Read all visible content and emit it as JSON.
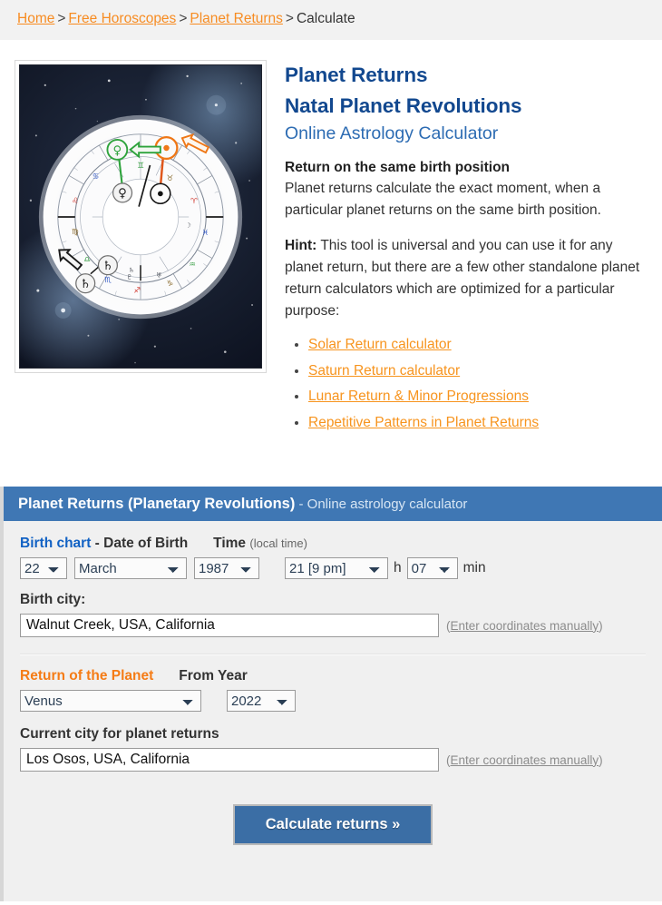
{
  "breadcrumb": {
    "items": [
      {
        "label": "Home",
        "link": true
      },
      {
        "label": "Free Horoscopes",
        "link": true
      },
      {
        "label": "Planet Returns",
        "link": true
      },
      {
        "label": "Calculate",
        "link": false
      }
    ],
    "separator": ">"
  },
  "intro": {
    "title_line1": "Planet Returns",
    "title_line2": "Natal Planet Revolutions",
    "subtitle": "Online Astrology Calculator",
    "section_heading": "Return on the same birth position",
    "paragraph": "Planet returns calculate the exact moment, when a particular planet returns on the same birth position.",
    "hint_label": "Hint:",
    "hint_text": " This tool is universal and you can use it for any planet return, but there are a few other standalone planet return calculators which are optimized for a particular purpose:",
    "links": [
      "Solar Return calculator",
      "Saturn Return calculator",
      "Lunar Return & Minor Progressions",
      "Repetitive Patterns in Planet Returns"
    ],
    "image_alt": "astrology-chart-wheel"
  },
  "calculator": {
    "header_main": "Planet Returns (Planetary Revolutions)",
    "header_sub": " - Online astrology calculator",
    "birth_chart_label": "Birth chart",
    "birth_chart_dash": " - ",
    "date_of_birth_label": "Date of Birth",
    "time_label": "Time",
    "time_note": "(local time)",
    "day_value": "22",
    "month_value": "March",
    "year_value": "1987",
    "hour_value": "21 [9 pm]",
    "hour_unit": "h",
    "minute_value": "07",
    "minute_unit": "min",
    "birth_city_label": "Birth city:",
    "birth_city_value": "Walnut Creek, USA, California",
    "coords_link": "(Enter coordinates manually)",
    "coords_link_open": "(",
    "coords_link_text": "Enter coordinates manually",
    "coords_link_close": ")",
    "return_planet_label": "Return of the Planet",
    "from_year_label": "From Year",
    "planet_value": "Venus",
    "from_year_value": "2022",
    "current_city_label": "Current city for planet returns",
    "current_city_value": "Los Osos, USA, California",
    "submit_label": "Calculate returns »"
  },
  "colors": {
    "accent_orange": "#f7941e",
    "title_blue": "#12488f",
    "panel_blue": "#3f77b4",
    "button_blue": "#3b6ea5",
    "label_blue": "#1262c4",
    "label_orange": "#f57c16",
    "panel_bg": "#f0f0f0",
    "breadcrumb_bg": "#f2f2f2"
  }
}
